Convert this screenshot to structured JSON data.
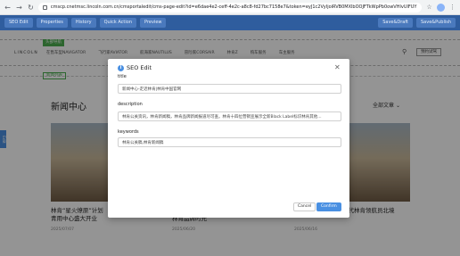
{
  "browser": {
    "url": "cmscp.cnetmsc.lincoln.com.cn/cmsportaledit/cms-page-edit?id=e6dae4e2-ceff-4e2c-a8c8-fd27bc7158e7&token=eyJ1c2VyIjoiRVB0MXlbOOJFTkWpPb0owVHlvUlFUYnZa..."
  },
  "cms_toolbar": {
    "seo_edit": "SEO Edit",
    "properties": "Properties",
    "history": "History",
    "quick_action": "Quick Action",
    "preview": "Preview",
    "save_draft": "Save&Draft",
    "save_publish": "Save&Publish"
  },
  "site": {
    "nav_tag": "头部导航",
    "logo": "LINCOLN",
    "nav_items": [
      "在售车型NAVIGATOR",
      "飞行家AVIATOR",
      "航海家NAUTILUS",
      "冒险家CORSAIR",
      "林肯Z",
      "购车服务",
      "车主服务"
    ],
    "nav_right_button": "预约试驾",
    "section_tag": "新闻列表",
    "news_title": "新闻中心",
    "filter_label": "全部文章",
    "side_tab": "Edit",
    "cards": [
      {
        "caption": "林肯“星火燎原”计划",
        "caption2": "青用中心盛大开业",
        "date": "2025/07/07"
      },
      {
        "caption": "林肯品牌时光",
        "caption2": "",
        "date": "2025/06/20"
      },
      {
        "caption": "一代林肯领航员北境",
        "caption2": "",
        "date": "2025/06/16"
      }
    ]
  },
  "seo_modal": {
    "title": "SEO Edit",
    "title_label": "title",
    "title_value": "新闻中心-走近林肯|林肯中国官网",
    "description_label": "description",
    "description_value": "林肯公关资讯，林肯新闻稿，林肯品牌新闻报道尽可查。林肯十四位营销宣展示全新Black Label标识林肯其他...",
    "keywords_label": "keywords",
    "keywords_value": "林肯公关稿,林肯新闻稿",
    "cancel": "Cancel",
    "confirm": "Confirm"
  },
  "colors": {
    "toolbar": "#2f5d9e",
    "primary": "#4a90e2",
    "tag_green": "#4caf50"
  }
}
